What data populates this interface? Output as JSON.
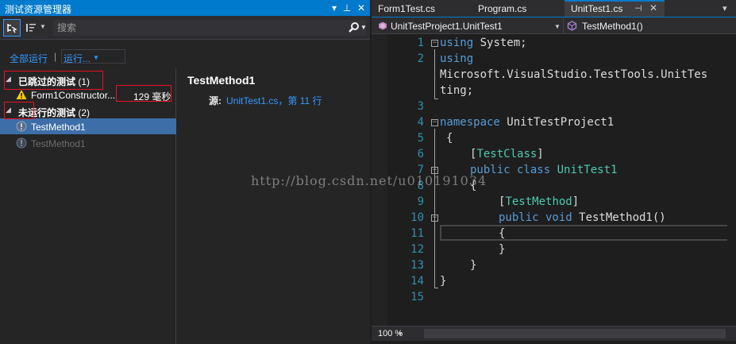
{
  "explorer": {
    "title": "测试资源管理器",
    "search_placeholder": "搜索",
    "run_all": "全部运行",
    "run_more": "运行...",
    "groups": [
      {
        "label": "已跳过的测试",
        "count": "(1)"
      },
      {
        "label": "未运行的测试",
        "count": "(2)"
      }
    ],
    "skipped_tests": [
      {
        "name": "Form1Constructor...",
        "duration": "129 毫秒",
        "status": "skipped-warning"
      }
    ],
    "not_run_tests": [
      {
        "name": "TestMethod1",
        "selected": true
      },
      {
        "name": "TestMethod1",
        "selected": false
      }
    ],
    "details": {
      "title": "TestMethod1",
      "source_label": "源:",
      "source_link": "UnitTest1.cs，第 11 行"
    }
  },
  "editor": {
    "tabs": [
      {
        "label": "Form1Test.cs",
        "active": false
      },
      {
        "label": "Program.cs",
        "active": false
      },
      {
        "label": "UnitTest1.cs",
        "active": true
      }
    ],
    "nav_left": "UnitTestProject1.UnitTest1",
    "nav_right": "TestMethod1()",
    "lines": {
      "l1": {
        "num": "1",
        "kw": "using",
        "rest": " System;"
      },
      "l2": {
        "num": "2",
        "kw": "using",
        "rest": "",
        "cont1": "Microsoft.VisualStudio.TestTools.UnitTes",
        "cont2": "ting;"
      },
      "l3": {
        "num": "3"
      },
      "l4": {
        "num": "4",
        "kw": "namespace",
        "rest": " UnitTestProject1"
      },
      "l5": {
        "num": "5",
        "text": "{"
      },
      "l6": {
        "num": "6",
        "open": "[",
        "type": "TestClass",
        "close": "]"
      },
      "l7": {
        "num": "7",
        "kw": "public class",
        "type": "UnitTest1"
      },
      "l8": {
        "num": "8",
        "text": "{"
      },
      "l9": {
        "num": "9",
        "open": "[",
        "type": "TestMethod",
        "close": "]"
      },
      "l10": {
        "num": "10",
        "kw": "public void",
        "rest": " TestMethod1()"
      },
      "l11": {
        "num": "11",
        "text": "{"
      },
      "l12": {
        "num": "12",
        "text": "}"
      },
      "l13": {
        "num": "13",
        "text": "}"
      },
      "l14": {
        "num": "14",
        "text": "}"
      },
      "l15": {
        "num": "15"
      }
    },
    "zoom": "100 %"
  },
  "watermark": "http://blog.csdn.net/u010191034",
  "colors": {
    "accent": "#007acc",
    "link": "#3399ff",
    "keyword": "#569cd6",
    "type": "#4ec9b0",
    "line_number": "#2b91af",
    "selection": "#3e6ea8",
    "annotation_red": "#e81123",
    "warning": "#ffcc00"
  }
}
